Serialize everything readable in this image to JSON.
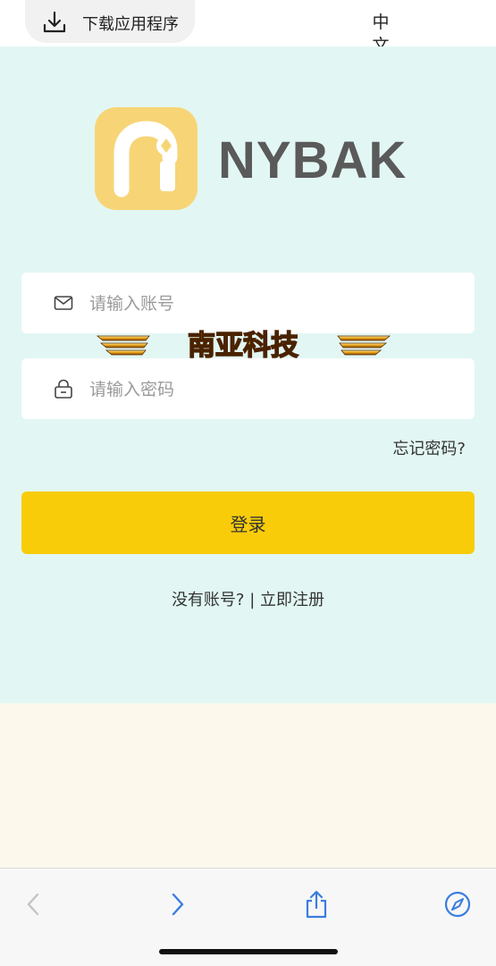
{
  "topbar": {
    "download_label": "下载应用程序",
    "language": [
      "中",
      "文"
    ]
  },
  "brand": {
    "name": "NYBAK"
  },
  "form": {
    "account_placeholder": "请输入账号",
    "password_placeholder": "请输入密码",
    "forgot_label": "忘记密码?",
    "login_label": "登录",
    "no_account_label": "没有账号?",
    "separator": "|",
    "register_label": "立即注册"
  },
  "watermark": {
    "text": "南亚科技"
  },
  "colors": {
    "main_bg": "#e2f7f3",
    "lower_bg": "#fcf8ec",
    "accent": "#f9cc0a",
    "logo_bg": "#f7d576",
    "browser_blue": "#3b7de0"
  },
  "toolbar": {
    "icons": [
      "back-icon",
      "forward-icon",
      "share-icon",
      "compass-icon"
    ]
  }
}
